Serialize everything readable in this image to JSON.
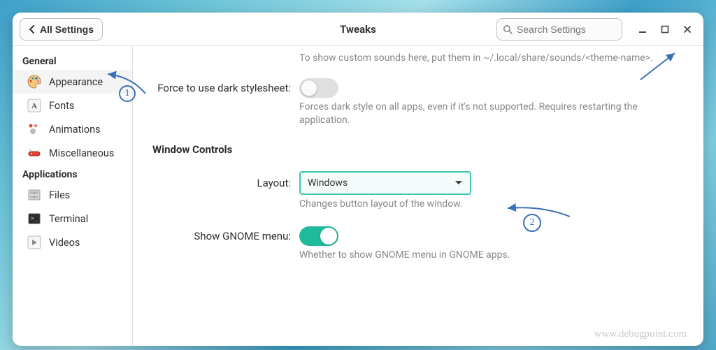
{
  "titlebar": {
    "back_label": "All Settings",
    "title": "Tweaks",
    "search_placeholder": "Search Settings"
  },
  "sidebar": {
    "categories": [
      {
        "name": "General",
        "items": [
          {
            "label": "Appearance",
            "icon": "palette"
          },
          {
            "label": "Fonts",
            "icon": "font"
          },
          {
            "label": "Animations",
            "icon": "animations"
          },
          {
            "label": "Miscellaneous",
            "icon": "swissknife"
          }
        ]
      },
      {
        "name": "Applications",
        "items": [
          {
            "label": "Files",
            "icon": "files"
          },
          {
            "label": "Terminal",
            "icon": "terminal"
          },
          {
            "label": "Videos",
            "icon": "videos"
          }
        ]
      }
    ]
  },
  "content": {
    "sound_hint": "To show custom sounds here, put them in ~/.local/share/sounds/<theme-name>.",
    "dark": {
      "label": "Force to use dark stylesheet:",
      "value": false,
      "desc": "Forces dark style on all apps, even if it's not supported. Requires restarting the application."
    },
    "window_controls_section": "Window Controls",
    "layout": {
      "label": "Layout:",
      "value": "Windows",
      "desc": "Changes button layout of the window."
    },
    "gnome_menu": {
      "label": "Show GNOME menu:",
      "value": true,
      "desc": "Whether to show GNOME menu in GNOME apps."
    }
  },
  "annotations": {
    "marker1": "1",
    "marker2": "2"
  },
  "watermark": "www.debugpoint.com"
}
